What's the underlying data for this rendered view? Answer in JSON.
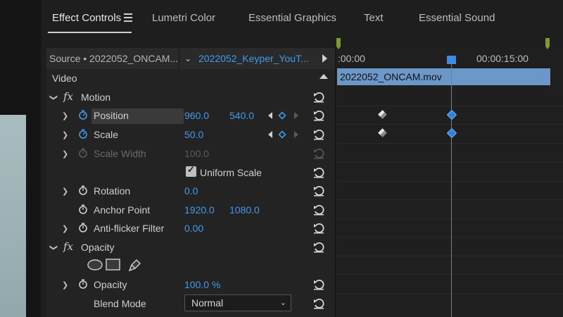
{
  "tabs": [
    {
      "label": "Effect Controls",
      "active": true
    },
    {
      "label": "Lumetri Color"
    },
    {
      "label": "Essential Graphics"
    },
    {
      "label": "Text"
    },
    {
      "label": "Essential Sound"
    }
  ],
  "source": {
    "label": "Source • 2022052_ONCAM...",
    "clip": "2022052_Keyper_YouT..."
  },
  "video_heading": "Video",
  "motion": {
    "label": "Motion",
    "position": {
      "label": "Position",
      "x": "960.0",
      "y": "540.0"
    },
    "scale": {
      "label": "Scale",
      "value": "50.0"
    },
    "scale_width": {
      "label": "Scale Width",
      "value": "100.0"
    },
    "uniform_scale": {
      "label": "Uniform Scale",
      "checked": true,
      "check_glyph": "✓"
    },
    "rotation": {
      "label": "Rotation",
      "value": "0.0"
    },
    "anchor_point": {
      "label": "Anchor Point",
      "x": "1920.0",
      "y": "1080.0"
    },
    "anti_flicker": {
      "label": "Anti-flicker Filter",
      "value": "0.00"
    }
  },
  "opacity": {
    "label": "Opacity",
    "opacity": {
      "label": "Opacity",
      "value": "100.0 %"
    },
    "blend_mode": {
      "label": "Blend Mode",
      "value": "Normal"
    }
  },
  "timeline": {
    "timecode_start": ":00:00",
    "timecode_mid": "00:00:15:00",
    "clip_name": "2022052_ONCAM.mov"
  },
  "colors": {
    "accent_blue": "#3f9aeb",
    "clip_bar": "#6b98c9",
    "marker_green": "#7f9a2f"
  },
  "icons": [
    "hamburger-menu-icon",
    "play-icon",
    "chevron-up-icon",
    "chevron-right-icon",
    "fx-icon",
    "stopwatch-icon",
    "reset-icon",
    "ellipse-mask-icon",
    "rectangle-mask-icon",
    "pen-mask-icon",
    "keyframe-icon",
    "dropdown-chevron-icon"
  ]
}
